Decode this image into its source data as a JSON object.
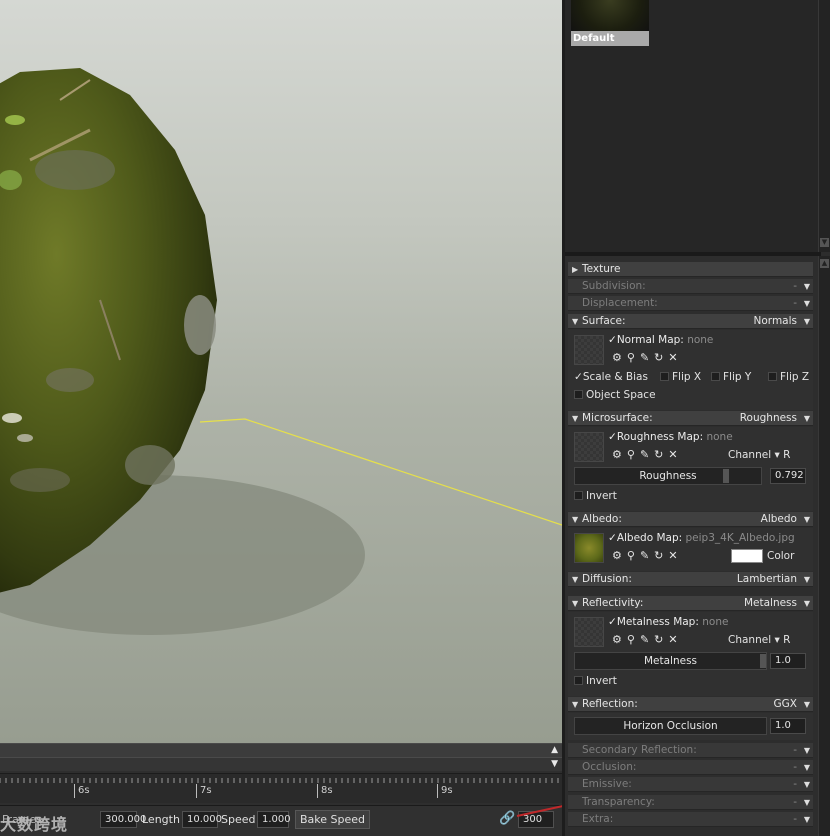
{
  "viewport": {},
  "timeline": {
    "ticks": [
      "6s",
      "7s",
      "8s",
      "9s"
    ],
    "watermark": "大数跨境",
    "frames_label": "Frames",
    "frames_value": "300.000",
    "length_label": "Length",
    "length_value": "10.000",
    "speed_label": "Speed",
    "speed_value": "1.000",
    "bake_speed_label": "Bake Speed",
    "frame_count": "300"
  },
  "material_preview": {
    "label": "Default"
  },
  "sections": {
    "texture": "Texture",
    "subdivision": "Subdivision:",
    "subdivision_mode": "-",
    "displacement": "Displacement:",
    "displacement_mode": "-",
    "surface": "Surface:",
    "surface_mode": "Normals",
    "microsurface": "Microsurface:",
    "microsurface_mode": "Roughness",
    "albedo": "Albedo:",
    "albedo_mode": "Albedo",
    "diffusion": "Diffusion:",
    "diffusion_mode": "Lambertian",
    "reflectivity": "Reflectivity:",
    "reflectivity_mode": "Metalness",
    "reflection": "Reflection:",
    "reflection_mode": "GGX",
    "secondary_reflection": "Secondary Reflection:",
    "secondary_reflection_mode": "-",
    "occlusion": "Occlusion:",
    "occlusion_mode": "-",
    "emissive": "Emissive:",
    "emissive_mode": "-",
    "transparency": "Transparency:",
    "transparency_mode": "-",
    "extra": "Extra:",
    "extra_mode": "-"
  },
  "surface": {
    "normal_map_label": "Normal Map:",
    "normal_map_value": "none",
    "scale_bias": "Scale & Bias",
    "flip_x": "Flip X",
    "flip_y": "Flip Y",
    "flip_z": "Flip Z",
    "object_space": "Object Space"
  },
  "microsurface": {
    "map_label": "Roughness Map:",
    "map_value": "none",
    "channel_label": "Channel",
    "channel_value": "R",
    "slider_label": "Roughness",
    "slider_value": "0.792",
    "invert": "Invert"
  },
  "albedo": {
    "map_label": "Albedo Map:",
    "map_value": "peip3_4K_Albedo.jpg",
    "color_label": "Color"
  },
  "reflectivity": {
    "map_label": "Metalness Map:",
    "map_value": "none",
    "channel_label": "Channel",
    "channel_value": "R",
    "slider_label": "Metalness",
    "slider_value": "1.0",
    "invert": "Invert"
  },
  "reflection": {
    "slider_label": "Horizon Occlusion",
    "slider_value": "1.0"
  },
  "colors": {
    "panel_bg": "#2d2d2d",
    "section_header": "#404040",
    "selection": "#a9a9a9"
  }
}
